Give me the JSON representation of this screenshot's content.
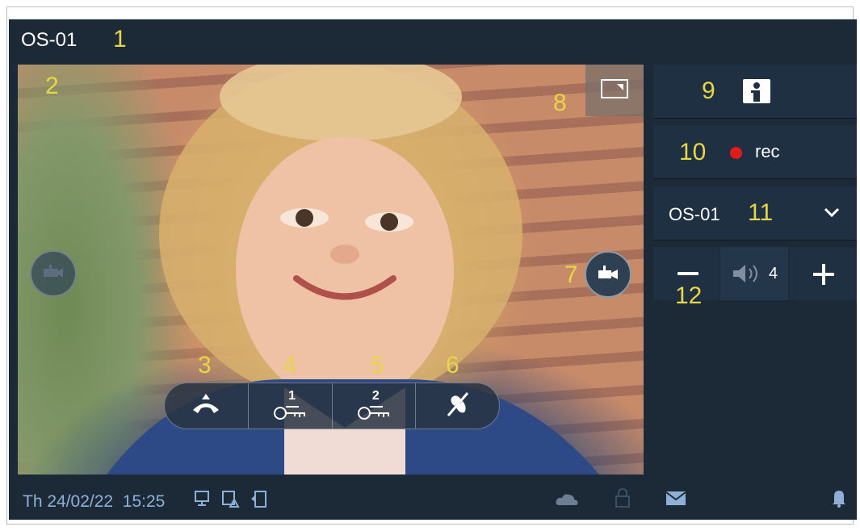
{
  "header": {
    "title": "OS-01"
  },
  "callouts": [
    "1",
    "2",
    "3",
    "4",
    "5",
    "6",
    "7",
    "8",
    "9",
    "10",
    "11",
    "12"
  ],
  "video": {
    "description_icons": [
      "camera-switch-left-icon",
      "camera-switch-right-icon",
      "pip-toggle-icon"
    ]
  },
  "actions": [
    {
      "name": "hang-up",
      "icon": "handset-icon"
    },
    {
      "name": "unlock-1",
      "icon": "key-1-icon",
      "number": "1"
    },
    {
      "name": "unlock-2",
      "icon": "key-2-icon",
      "number": "2"
    },
    {
      "name": "mute",
      "icon": "mic-off-icon"
    }
  ],
  "panel": {
    "rec_label": "rec",
    "source_select": "OS-01",
    "volume": "4"
  },
  "status": {
    "date": "Th 24/02/22",
    "time": "15:25"
  },
  "colors": {
    "accent_callout": "#e7d646",
    "background": "#1c2a38",
    "rec_dot": "#e01b1b",
    "status_text": "#8fb0d6"
  }
}
